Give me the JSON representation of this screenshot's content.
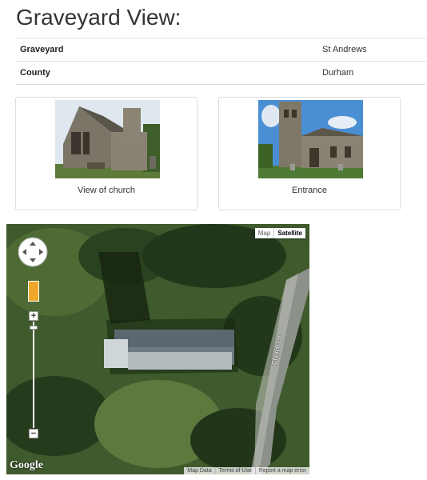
{
  "page": {
    "title": "Graveyard View:"
  },
  "details": [
    {
      "key": "Graveyard",
      "value": "St Andrews"
    },
    {
      "key": "County",
      "value": "Durham"
    }
  ],
  "photos": [
    {
      "caption": "View of church"
    },
    {
      "caption": "Entrance"
    }
  ],
  "map": {
    "type_buttons": [
      "Map",
      "Satellite"
    ],
    "selected_type": "Satellite",
    "zoom_in": "+",
    "zoom_out": "−",
    "logo": "Google",
    "road_label": "Church Ln",
    "footer_links": [
      "Map Data",
      "Terms of Use",
      "Report a map error"
    ]
  }
}
